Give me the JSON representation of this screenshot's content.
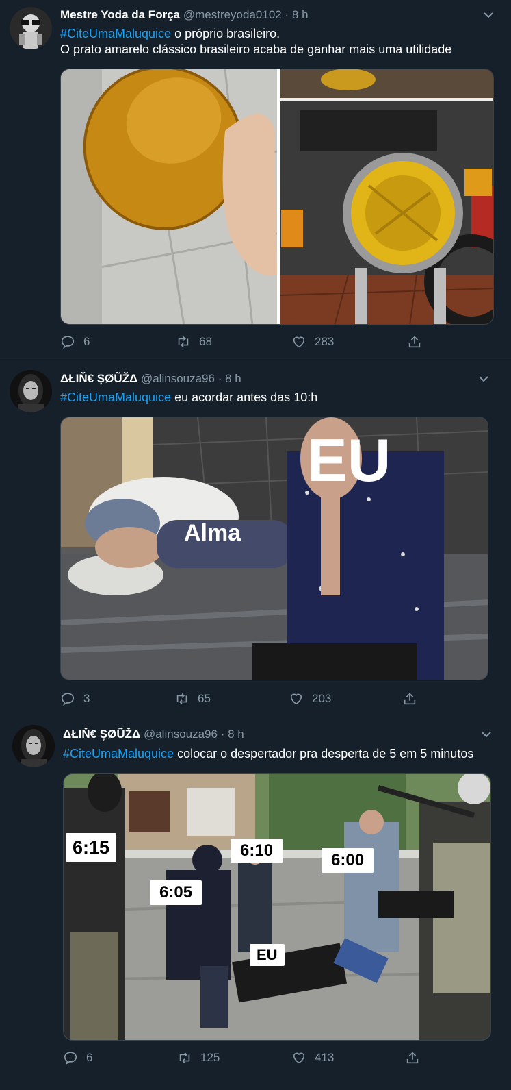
{
  "tweets": [
    {
      "name": "Mestre Yoda da Força",
      "handle": "@mestreyoda0102",
      "sep": "·",
      "time": "8 h",
      "hashtag": "#CiteUmaMaluquice",
      "text_line1": " o próprio brasileiro.",
      "text_line2": "O prato amarelo clássico brasileiro acaba de ganhar mais uma utilidade",
      "replies": "6",
      "retweets": "68",
      "likes": "283"
    },
    {
      "name": "ΔŁIŇ€ ȘØŨŽΔ",
      "handle": "@alinsouza96",
      "sep": "·",
      "time": "8 h",
      "hashtag": "#CiteUmaMaluquice",
      "text_line1": " eu acordar antes das 10:h",
      "meme_labels": {
        "eu": "EU",
        "alma": "Alma"
      },
      "replies": "3",
      "retweets": "65",
      "likes": "203"
    },
    {
      "name": "ΔŁIŇ€ ȘØŨŽΔ",
      "handle": "@alinsouza96",
      "sep": "·",
      "time": "8 h",
      "hashtag": "#CiteUmaMaluquice",
      "text_line1": " colocar o despertador pra desperta de 5 em 5 minutos",
      "meme_labels": {
        "t615": "6:15",
        "t610": "6:10",
        "t600": "6:00",
        "t605": "6:05",
        "eu": "EU"
      },
      "replies": "6",
      "retweets": "125",
      "likes": "413"
    }
  ],
  "colors": {
    "background": "#15202b",
    "hashtag": "#1da1f2",
    "secondary_text": "#8899a6",
    "divider": "#38444d"
  },
  "icons": [
    "reply-icon",
    "retweet-icon",
    "like-icon",
    "share-icon",
    "chevron-down-icon"
  ]
}
